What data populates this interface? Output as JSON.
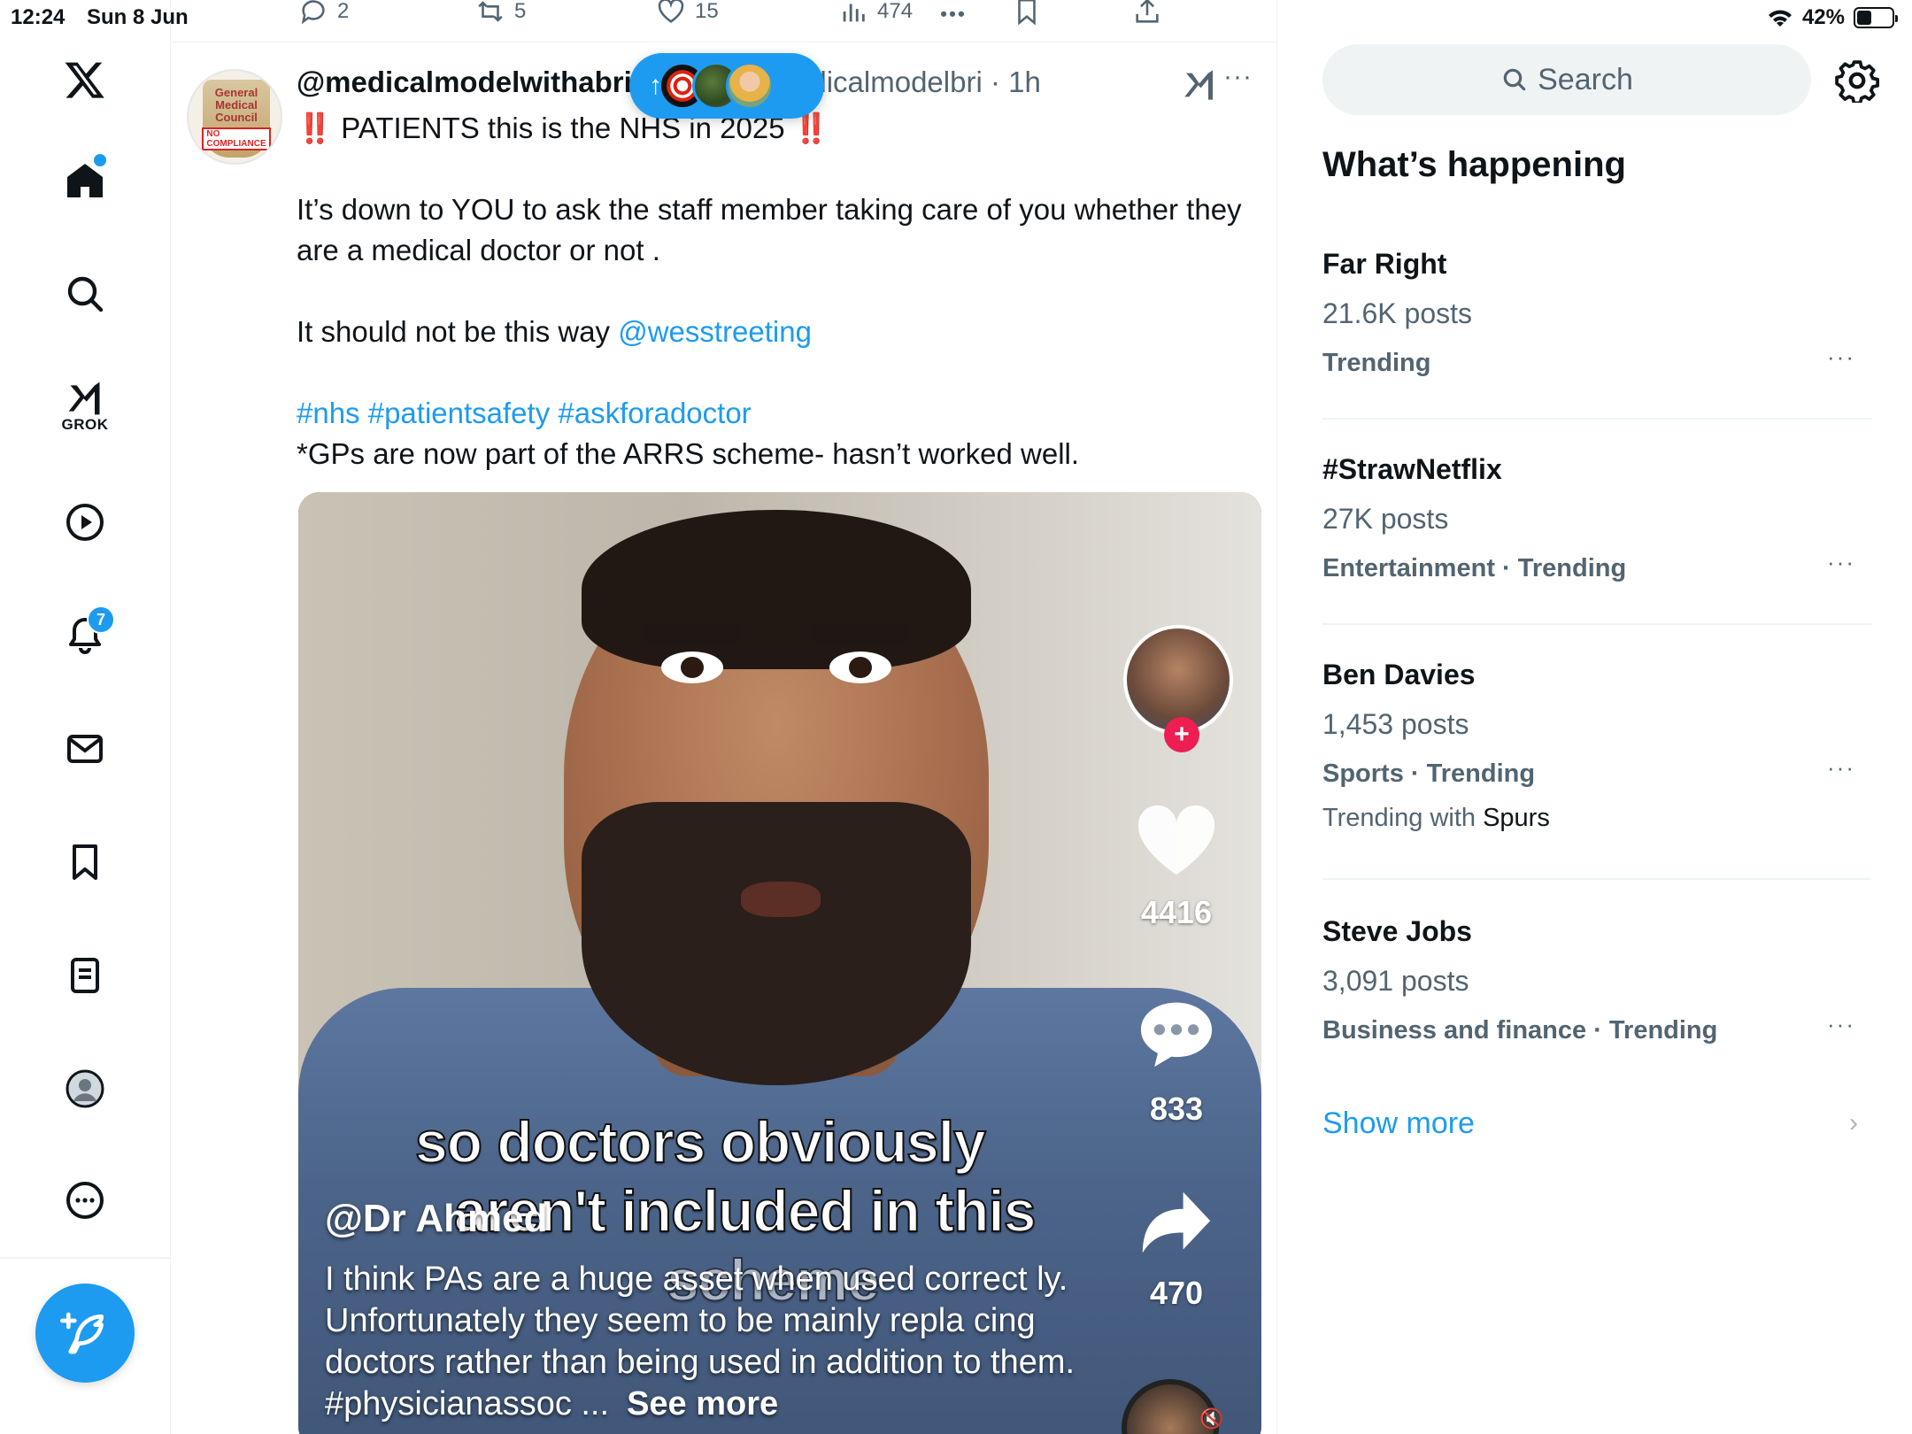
{
  "status_bar": {
    "time": "12:24",
    "date": "Sun 8 Jun",
    "battery": "42%",
    "battery_level": 0.42
  },
  "nav": {
    "grok_label": "GROK",
    "notifications_count": "7",
    "items": [
      "home-icon",
      "search-icon",
      "grok-icon",
      "video-icon",
      "bell-icon",
      "mail-icon",
      "bookmark-icon",
      "list-icon",
      "profile-icon",
      "more-icon"
    ]
  },
  "post_actions": {
    "replies": "2",
    "reposts": "5",
    "likes": "15",
    "views": "474"
  },
  "post": {
    "name": "@medicalmodelwithabri",
    "handle": "edicalmodelbri",
    "time": "· 1h",
    "more": "···",
    "line1": "PATIENTS this is the NHS in 2025",
    "bang": "‼️",
    "line2": "It’s down to YOU to ask the staff member taking care of you whether they are a medical doctor or not .",
    "line3_prefix": "It should not be this way",
    "mention": "@wesstreeting",
    "hashtags": "#nhs #patientsafety #askforadoctor",
    "line4": "*GPs are now part of the ARRS scheme- hasn’t worked well.",
    "avatar_text": [
      "General",
      "Medical",
      "Council"
    ],
    "avatar_banner": "NO COMPLIANCE"
  },
  "pill": {
    "arrow": "↑"
  },
  "video": {
    "likes": "4416",
    "comments": "833",
    "shares": "470",
    "caption_line1": "so doctors obviously",
    "caption_line2": "aren't included in this",
    "caption_line3": "scheme",
    "author": "@Dr Ahmed",
    "description": "I think PAs are a huge asset when used correct ly. Unfortunately they seem to be mainly repla cing doctors rather than being used in addition to them. #physicianassoc ...",
    "see_more": "See more"
  },
  "right": {
    "search_placeholder": "Search",
    "heading": "What’s happening",
    "trends": [
      {
        "name": "Far Right",
        "count": "21.6K posts",
        "category": "Trending"
      },
      {
        "name": "#StrawNetflix",
        "count": "27K posts",
        "category": "Entertainment · Trending"
      },
      {
        "name": "Ben Davies",
        "count": "1,453 posts",
        "category": "Sports · Trending",
        "with_prefix": "Trending with",
        "with_name": "Spurs"
      },
      {
        "name": "Steve Jobs",
        "count": "3,091 posts",
        "category": "Business and finance · Trending"
      }
    ],
    "show_more": "Show more",
    "more": "···"
  },
  "colors": {
    "accent": "#1d9bf0",
    "text": "#0f1419",
    "secondary": "#536471",
    "tiktok_red": "#ee1d52"
  }
}
